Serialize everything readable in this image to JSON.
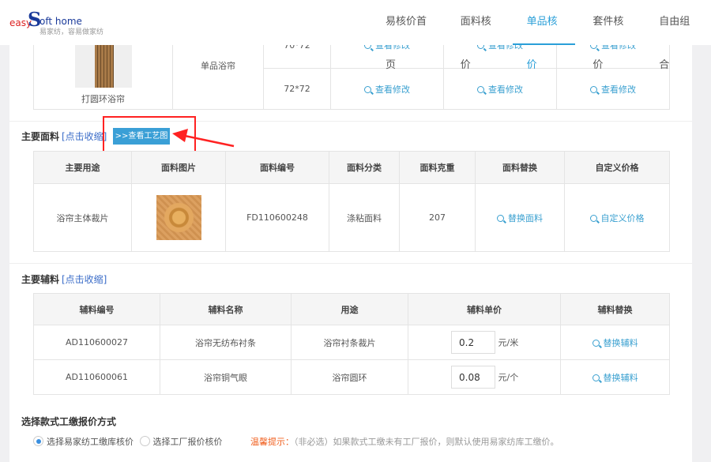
{
  "logo": {
    "easy": "easy",
    "s": "S",
    "oft": "oft home",
    "tagline": "易家纺，容易做家纺"
  },
  "nav": [
    {
      "label": "易核价首页"
    },
    {
      "label": "面料核价"
    },
    {
      "label": "单品核价",
      "active": true
    },
    {
      "label": "套件核价"
    },
    {
      "label": "自由组合"
    }
  ],
  "product": {
    "name": "打圆环浴帘",
    "type": "单品浴帘",
    "sizes": [
      "70*72",
      "72*72"
    ],
    "action": "查看修改"
  },
  "fabric": {
    "title": "主要面料",
    "toggle": "[点击收缩]",
    "craft_button": ">>查看工艺图",
    "headers": [
      "主要用途",
      "面料图片",
      "面料编号",
      "面料分类",
      "面料克重",
      "面料替换",
      "自定义价格"
    ],
    "rows": [
      {
        "use": "浴帘主体裁片",
        "code": "FD110600248",
        "category": "涤粘面料",
        "weight": "207",
        "replace": "替换面料",
        "custom": "自定义价格"
      }
    ]
  },
  "aux": {
    "title": "主要辅料",
    "toggle": "[点击收缩]",
    "headers": [
      "辅料编号",
      "辅料名称",
      "用途",
      "辅料单价",
      "辅料替换"
    ],
    "rows": [
      {
        "code": "AD110600027",
        "name": "浴帘无纺布衬条",
        "use": "浴帘衬条裁片",
        "price": "0.2",
        "unit": "元/米",
        "replace": "替换辅料"
      },
      {
        "code": "AD110600061",
        "name": "浴帘铜气眼",
        "use": "浴帘圆环",
        "price": "0.08",
        "unit": "元/个",
        "replace": "替换辅料"
      }
    ]
  },
  "pricing": {
    "title": "选择款式工缴报价方式",
    "option1": "选择易家纺工缴库核价",
    "option2": "选择工厂报价核价",
    "tip_label": "温馨提示：",
    "tip": "（非必选）如果款式工缴未有工厂报价，则默认使用易家纺库工缴价。"
  },
  "colors": {
    "accent": "#2a9fd8",
    "button": "#3a9fd6",
    "highlight": "#ff2222",
    "tip": "#f06020"
  }
}
